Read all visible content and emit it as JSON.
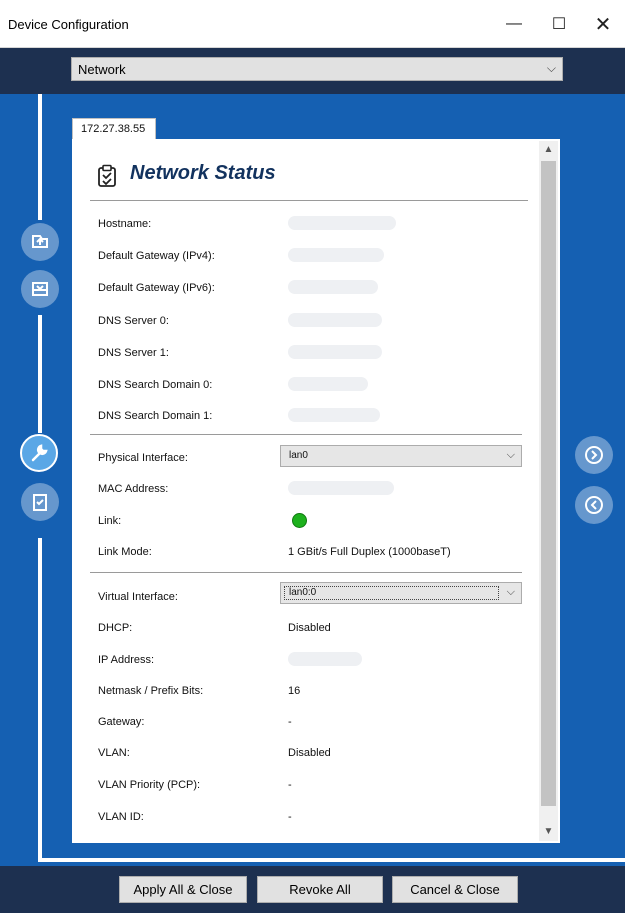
{
  "window": {
    "title": "Device Configuration",
    "minimize_glyph": "—",
    "maximize_glyph": "☐",
    "close_glyph": "✕"
  },
  "top": {
    "category_value": "Network",
    "chevron": "⌵"
  },
  "tab": {
    "label": "172.27.38.55"
  },
  "panel": {
    "title": "Network Status",
    "title_icon": "clipboard-check-icon"
  },
  "fields": {
    "hostname": "Hostname:",
    "gateway_ipv4": "Default Gateway (IPv4):",
    "gateway_ipv6": "Default Gateway (IPv6):",
    "dns0": "DNS Server 0:",
    "dns1": "DNS Server 1:",
    "dns_domain0": "DNS Search Domain 0:",
    "dns_domain1": "DNS Search Domain 1:",
    "physical_iface_label": "Physical Interface:",
    "physical_iface_value": "lan0",
    "mac_label": "MAC Address:",
    "link_label": "Link:",
    "link_status_color": "#1db11d",
    "link_mode_label": "Link Mode:",
    "link_mode_value": "1 GBit/s Full Duplex (1000baseT)",
    "virtual_iface_label": "Virtual Interface:",
    "virtual_iface_value": "lan0:0",
    "dhcp_label": "DHCP:",
    "dhcp_value": "Disabled",
    "ip_label": "IP Address:",
    "netmask_label": "Netmask / Prefix Bits:",
    "netmask_value": "16",
    "gateway_label": "Gateway:",
    "gateway_value": "-",
    "vlan_label": "VLAN:",
    "vlan_value": "Disabled",
    "vlan_priority_label": "VLAN Priority (PCP):",
    "vlan_priority_value": "-",
    "vlan_id_label": "VLAN ID:",
    "vlan_id_value": "-"
  },
  "side_nav": {
    "left": [
      "upload-icon",
      "download-icon",
      "wrench-icon",
      "clipboard-check-icon"
    ],
    "right": [
      "arrow-right-circle-icon",
      "arrow-left-circle-icon"
    ]
  },
  "buttons": {
    "apply": "Apply All & Close",
    "revoke": "Revoke All",
    "cancel": "Cancel & Close"
  },
  "colors": {
    "accent_blue": "#1560b2",
    "dark_navy": "#1d3050",
    "title_navy": "#12325e"
  }
}
